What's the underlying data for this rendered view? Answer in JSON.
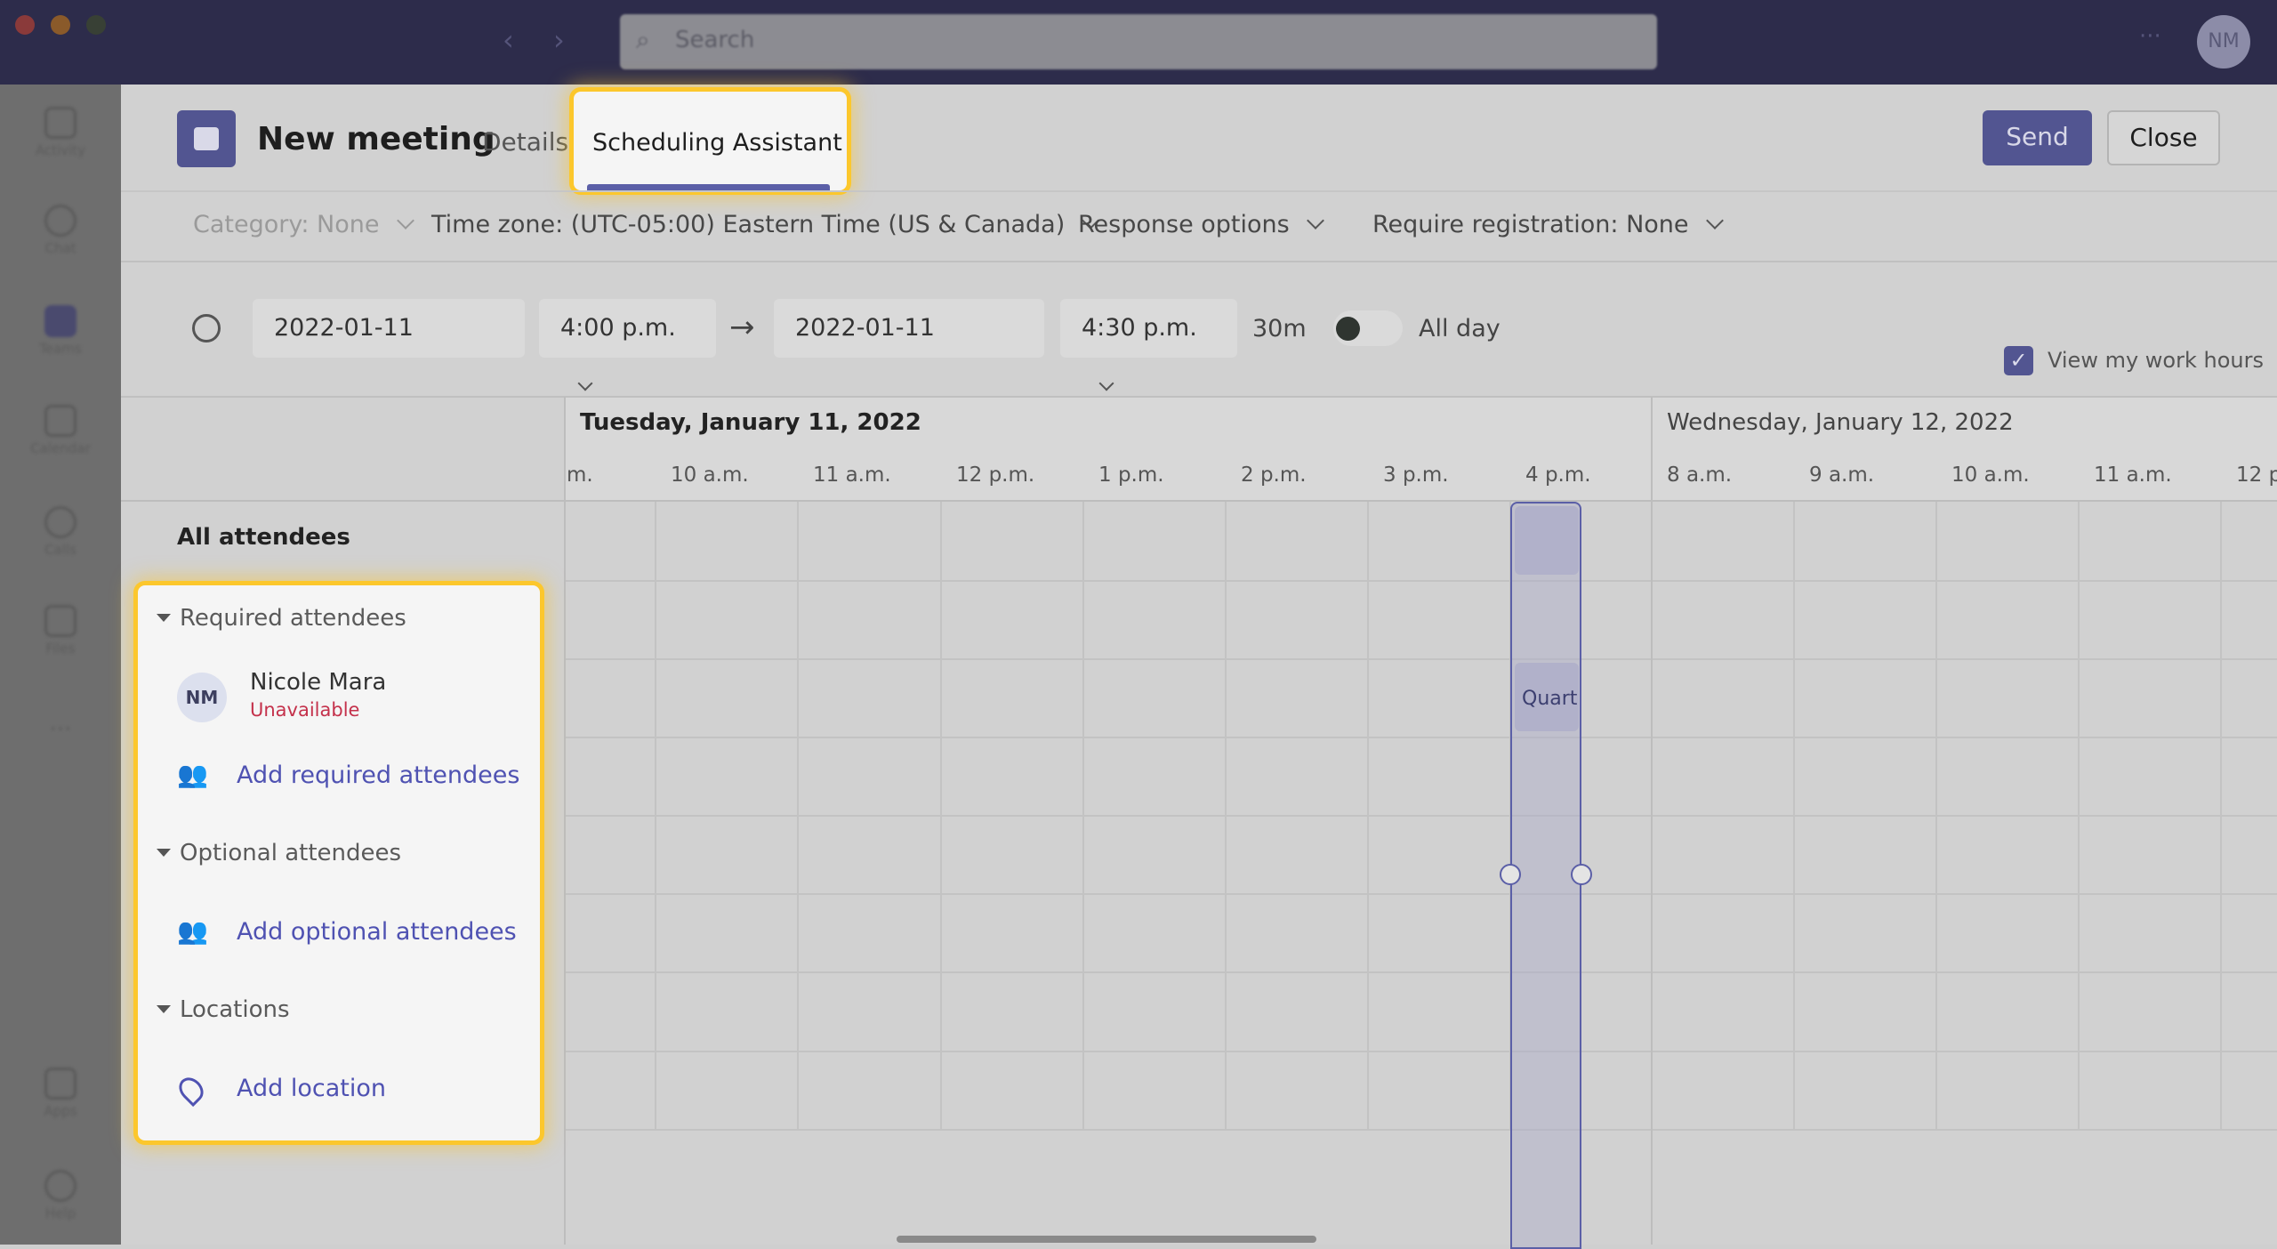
{
  "titlebar": {
    "search_placeholder": "Search",
    "more": "···",
    "avatar": "NM"
  },
  "rail": [
    {
      "label": "Activity"
    },
    {
      "label": "Chat"
    },
    {
      "label": "Teams"
    },
    {
      "label": "Calendar"
    },
    {
      "label": "Calls"
    },
    {
      "label": "Files"
    },
    {
      "label": "···"
    },
    {
      "label": "Apps"
    },
    {
      "label": "Help"
    }
  ],
  "header": {
    "title": "New meeting",
    "tabs": [
      {
        "label": "Details"
      },
      {
        "label": "Scheduling Assistant",
        "active": true
      }
    ],
    "send": "Send",
    "close": "Close"
  },
  "options": {
    "category": "Category: None",
    "timezone": "Time zone: (UTC-05:00) Eastern Time (US & Canada)",
    "response": "Response options",
    "registration": "Require registration: None"
  },
  "datetime": {
    "start_date": "2022-01-11",
    "start_time": "4:00 p.m.",
    "end_date": "2022-01-11",
    "end_time": "4:30 p.m.",
    "duration": "30m",
    "all_day_label": "All day",
    "all_day": false,
    "work_hours_label": "View my work hours",
    "work_hours": true
  },
  "grid": {
    "days": [
      {
        "label": "Tuesday, January 11, 2022",
        "hours": [
          "m.",
          "10 a.m.",
          "11 a.m.",
          "12 p.m.",
          "1 p.m.",
          "2 p.m.",
          "3 p.m.",
          "4 p.m."
        ]
      },
      {
        "label": "Wednesday, January 12, 2022",
        "hours": [
          "8 a.m.",
          "9 a.m.",
          "10 a.m.",
          "11 a.m.",
          "12 p."
        ]
      }
    ],
    "busy_label": "Quart"
  },
  "attendees": {
    "all": "All attendees",
    "required_header": "Required attendees",
    "people": [
      {
        "initials": "NM",
        "name": "Nicole Mara",
        "status": "Unavailable"
      }
    ],
    "add_required": "Add required attendees",
    "optional_header": "Optional attendees",
    "add_optional": "Add optional attendees",
    "locations_header": "Locations",
    "add_location": "Add location"
  },
  "colors": {
    "brand": "#5b5fa7",
    "highlight": "#fcc72c",
    "unavailable": "#c4314b",
    "link": "#4f52b2"
  }
}
